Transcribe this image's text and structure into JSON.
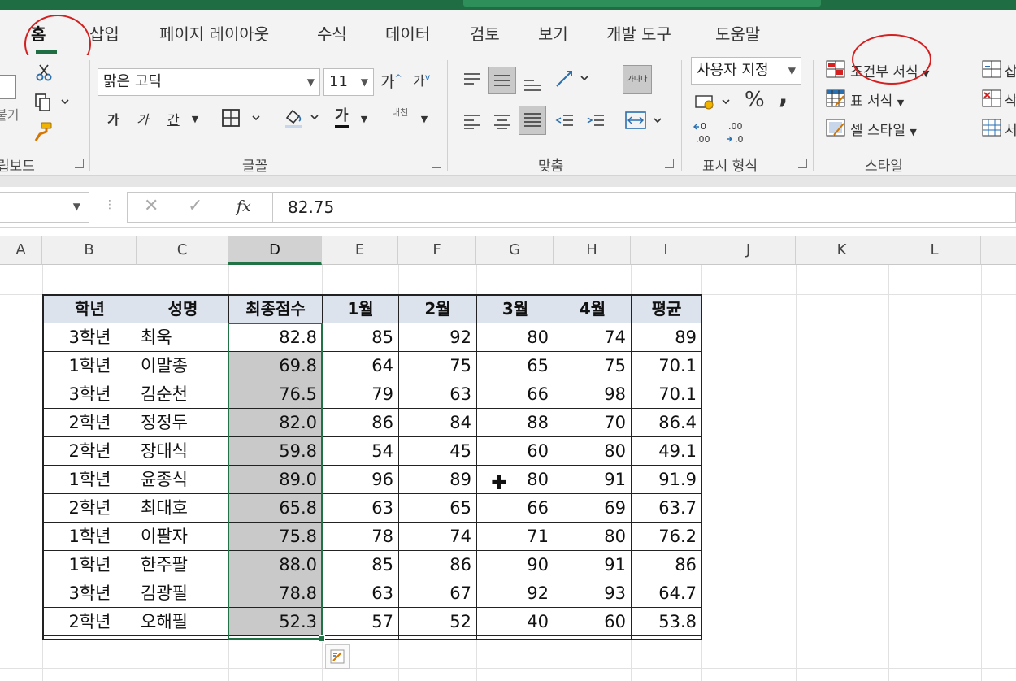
{
  "tabs": [
    "홈",
    "삽입",
    "페이지 레이아웃",
    "수식",
    "데이터",
    "검토",
    "보기",
    "개발 도구",
    "도움말"
  ],
  "clipboard": {
    "paste_partial": "붙기",
    "group_label": "립보드"
  },
  "font": {
    "name": "맑은 고딕",
    "size": "11",
    "grow": "가",
    "shrink": "가",
    "bold": "가",
    "italic": "가",
    "underline": "간",
    "color_letter": "가",
    "phonetic": "내천",
    "group_label": "글꼴"
  },
  "alignment": {
    "wrap_text": "가나다",
    "group_label": "맞춤"
  },
  "number": {
    "format": "사용자 지정",
    "percent": "%",
    "comma": ",",
    "inc_decimal": ".00",
    "dec_decimal": ".00",
    "group_label": "표시 형식"
  },
  "styles": {
    "conditional": "조건부 서식",
    "table_format": "표 서식",
    "cell_style": "셀 스타일",
    "group_label": "스타일"
  },
  "cells_partial": {
    "insert": "삽",
    "delete": "삭",
    "format": "서"
  },
  "formula_bar": {
    "name_box": "",
    "fx": "fx",
    "value": "82.75"
  },
  "columns": [
    "A",
    "B",
    "C",
    "D",
    "E",
    "F",
    "G",
    "H",
    "I",
    "J",
    "K",
    "L"
  ],
  "table": {
    "headers": [
      "학년",
      "성명",
      "최종점수",
      "1월",
      "2월",
      "3월",
      "4월",
      "평균"
    ],
    "rows": [
      [
        "3학년",
        "최욱",
        "82.8",
        "85",
        "92",
        "80",
        "74",
        "89"
      ],
      [
        "1학년",
        "이말종",
        "69.8",
        "64",
        "75",
        "65",
        "75",
        "70.1"
      ],
      [
        "3학년",
        "김순천",
        "76.5",
        "79",
        "63",
        "66",
        "98",
        "70.1"
      ],
      [
        "2학년",
        "정정두",
        "82.0",
        "86",
        "84",
        "88",
        "70",
        "86.4"
      ],
      [
        "2학년",
        "장대식",
        "59.8",
        "54",
        "45",
        "60",
        "80",
        "49.1"
      ],
      [
        "1학년",
        "윤종식",
        "89.0",
        "96",
        "89",
        "80",
        "91",
        "91.9"
      ],
      [
        "2학년",
        "최대호",
        "65.8",
        "63",
        "65",
        "66",
        "69",
        "63.7"
      ],
      [
        "1학년",
        "이팔자",
        "75.8",
        "78",
        "74",
        "71",
        "80",
        "76.2"
      ],
      [
        "1학년",
        "한주팔",
        "88.0",
        "85",
        "86",
        "90",
        "91",
        "86"
      ],
      [
        "3학년",
        "김광필",
        "78.8",
        "63",
        "67",
        "92",
        "93",
        "64.7"
      ],
      [
        "2학년",
        "오해필",
        "52.3",
        "57",
        "52",
        "40",
        "60",
        "53.8"
      ]
    ]
  },
  "colors": {
    "excel_green": "#217346",
    "selection_gray": "#c9c9c9",
    "header_fill": "#dde3ec",
    "annotation_red": "#d42020"
  }
}
